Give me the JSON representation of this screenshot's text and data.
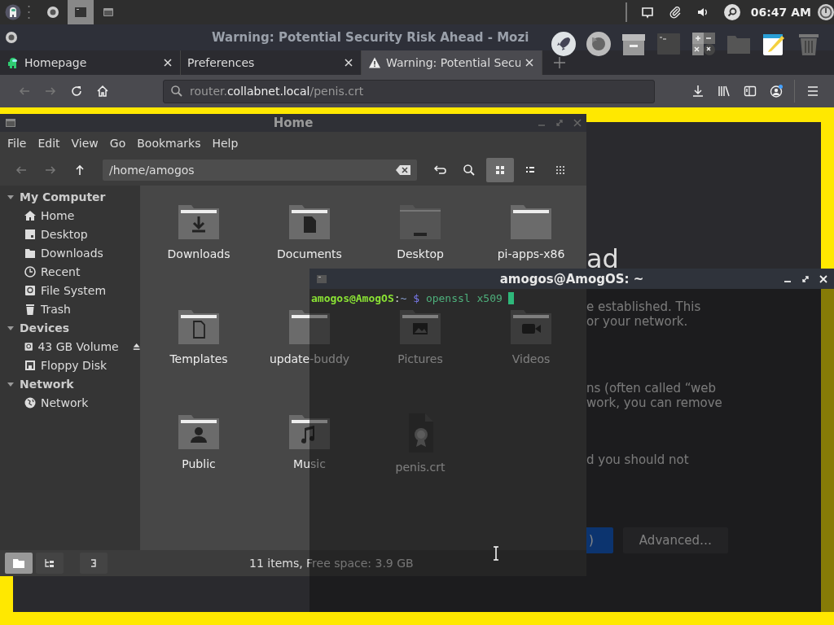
{
  "panel": {
    "launchers": [
      {
        "kind": "firefox",
        "selected": false
      },
      {
        "kind": "terminal",
        "selected": true
      },
      {
        "kind": "window",
        "selected": false
      }
    ],
    "tray": [
      {
        "kind": "screen"
      },
      {
        "kind": "clip"
      },
      {
        "kind": "volume"
      },
      {
        "kind": "search"
      }
    ],
    "clock": "06:47 AM"
  },
  "browser": {
    "title": "Warning: Potential Security Risk Ahead - Mozi",
    "tabs": [
      {
        "label": "Homepage",
        "kind": "figure",
        "selected": false
      },
      {
        "label": "Preferences",
        "kind": "plain",
        "selected": false
      },
      {
        "label": "Warning: Potential Secu",
        "kind": "warning",
        "selected": true
      }
    ],
    "url": {
      "subdomain": "router.",
      "domain": "collabnet.local",
      "path": "/penis.crt"
    },
    "page": {
      "heading": "ad",
      "paragraphs": [
        [
          "e established. This",
          "or your network."
        ],
        [
          "ns (often called “web",
          "work, you can remove"
        ],
        [
          "d you should not"
        ]
      ],
      "buttons": [
        {
          "label": ")",
          "kind": "primary"
        },
        {
          "label": "Advanced…",
          "kind": "secondary"
        }
      ]
    }
  },
  "dock": [
    {
      "kind": "rocket"
    },
    {
      "kind": "firefox"
    },
    {
      "kind": "archive"
    },
    {
      "kind": "terminal"
    },
    {
      "kind": "calculator"
    },
    {
      "kind": "folder"
    },
    {
      "kind": "notepad"
    },
    {
      "kind": "trash"
    }
  ],
  "files": {
    "title": "Home",
    "menu": [
      "File",
      "Edit",
      "View",
      "Go",
      "Bookmarks",
      "Help"
    ],
    "path": "/home/amogos",
    "views": [
      {
        "kind": "grid",
        "selected": true
      },
      {
        "kind": "list",
        "selected": false
      },
      {
        "kind": "compact",
        "selected": false
      }
    ],
    "sidebar": [
      {
        "label": "My Computer",
        "expanded": true,
        "children": [
          {
            "label": "Home",
            "kind": "home"
          },
          {
            "label": "Desktop",
            "kind": "desktop"
          },
          {
            "label": "Downloads",
            "kind": "folder"
          },
          {
            "label": "Recent",
            "kind": "clock"
          },
          {
            "label": "File System",
            "kind": "drive"
          },
          {
            "label": "Trash",
            "kind": "trash"
          }
        ]
      },
      {
        "label": "Devices",
        "expanded": true,
        "children": [
          {
            "label": "43 GB Volume",
            "kind": "drive",
            "eject": true
          },
          {
            "label": "Floppy Disk",
            "kind": "floppy"
          }
        ]
      },
      {
        "label": "Network",
        "expanded": true,
        "children": [
          {
            "label": "Network",
            "kind": "globe"
          }
        ]
      }
    ],
    "items": [
      {
        "name": "Downloads",
        "kind": "download"
      },
      {
        "name": "Documents",
        "kind": "document"
      },
      {
        "name": "Desktop",
        "kind": "desktop"
      },
      {
        "name": "pi-apps-x86",
        "kind": "plain"
      },
      {
        "name": "Templates",
        "kind": "template"
      },
      {
        "name": "update-buddy",
        "kind": "plain"
      },
      {
        "name": "Pictures",
        "kind": "picture"
      },
      {
        "name": "Videos",
        "kind": "video"
      },
      {
        "name": "Public",
        "kind": "user"
      },
      {
        "name": "Music",
        "kind": "music"
      },
      {
        "name": "penis.crt",
        "kind": "certificate"
      }
    ],
    "panes": [
      {
        "kind": "places",
        "selected": true
      },
      {
        "kind": "tree",
        "selected": false
      },
      {
        "kind": "terminal",
        "selected": false
      }
    ],
    "status": "11 items, Free space: 3.9 GB"
  },
  "terminal": {
    "title": "amogos@AmogOS: ~",
    "user": "amogos@AmogOS",
    "separator": ":",
    "cwd": "~",
    "symbol": "$",
    "command": "openssl x509"
  }
}
